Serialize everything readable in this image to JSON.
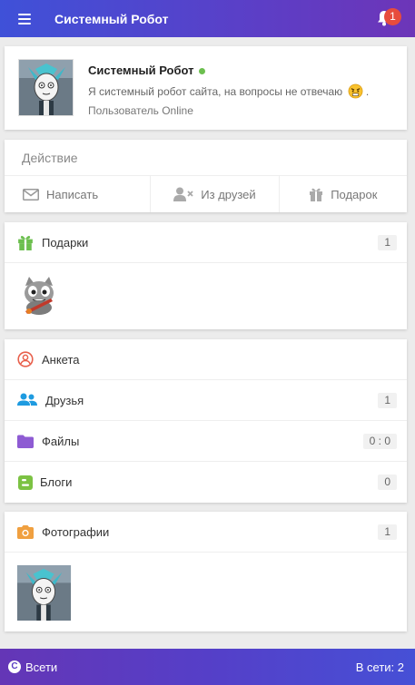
{
  "header": {
    "title": "Системный Робот",
    "notification_count": "1"
  },
  "profile": {
    "name": "Системный Робот",
    "status": "Я системный робот сайта, на вопросы не отвечаю",
    "status_suffix": ".",
    "online_text": "Пользователь Online"
  },
  "actions": {
    "heading": "Действие",
    "write": "Написать",
    "unfriend": "Из друзей",
    "gift": "Подарок"
  },
  "gifts": {
    "label": "Подарки",
    "count": "1"
  },
  "menu": {
    "items": [
      {
        "label": "Анкета",
        "count": ""
      },
      {
        "label": "Друзья",
        "count": "1"
      },
      {
        "label": "Файлы",
        "count": "0 : 0"
      },
      {
        "label": "Блоги",
        "count": "0"
      }
    ]
  },
  "photos": {
    "label": "Фотографии",
    "count": "1"
  },
  "footer": {
    "left_label": "Всети",
    "online_count": "В сети: 2"
  },
  "colors": {
    "header_gradient_start": "#3f51d8",
    "header_gradient_end": "#6d35b8",
    "badge": "#e74c3c",
    "online_dot": "#6cbf4f",
    "gift_icon": "#6cbf4f",
    "profile_icon": "#e8604c",
    "friends_icon": "#1e9be0",
    "files_icon": "#8e5bd3",
    "blogs_icon": "#7cc243",
    "photos_icon": "#f0a040"
  }
}
